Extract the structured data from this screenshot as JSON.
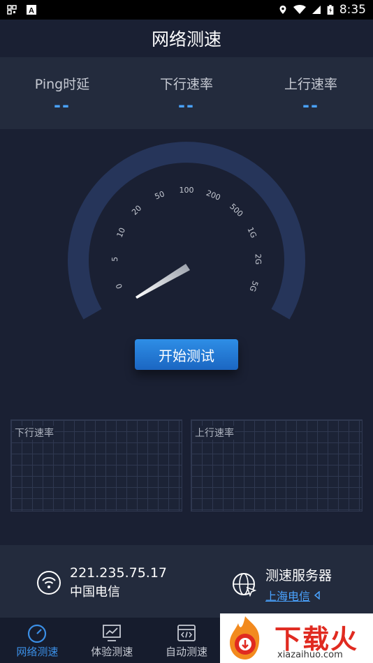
{
  "status_bar": {
    "time": "8:35",
    "left_icons": [
      "qr-notification-icon",
      "a-notification-icon"
    ],
    "right_icons": [
      "location-icon",
      "wifi-icon",
      "signal-icon",
      "battery-icon"
    ]
  },
  "header": {
    "title": "网络测速"
  },
  "stats": [
    {
      "label": "Ping时延",
      "value": "--"
    },
    {
      "label": "下行速率",
      "value": "--"
    },
    {
      "label": "上行速率",
      "value": "--"
    }
  ],
  "gauge": {
    "ticks": [
      "0",
      "5",
      "10",
      "20",
      "50",
      "100",
      "200",
      "500",
      "1G",
      "2G",
      "5G"
    ],
    "needle_value": "0"
  },
  "start_button": {
    "label": "开始测试"
  },
  "charts": {
    "download_title": "下行速率",
    "upload_title": "上行速率"
  },
  "network_info": {
    "ip": "221.235.75.17",
    "carrier": "中国电信",
    "server_label": "测速服务器",
    "server_name": "上海电信"
  },
  "tabs": [
    {
      "label": "网络测速",
      "icon": "speedometer-icon",
      "active": true
    },
    {
      "label": "体验测速",
      "icon": "monitor-chart-icon",
      "active": false
    },
    {
      "label": "自动测速",
      "icon": "code-window-icon",
      "active": false
    },
    {
      "label": "",
      "icon": "more-icon",
      "active": false
    },
    {
      "label": "",
      "icon": "more-icon",
      "active": false
    }
  ],
  "watermark": {
    "text": "下载火",
    "sub": "xiazaihuo.com"
  },
  "colors": {
    "accent": "#3b8fe6",
    "background": "#1a2033",
    "panel": "#232b3d",
    "gauge_arc": "#26355a"
  }
}
